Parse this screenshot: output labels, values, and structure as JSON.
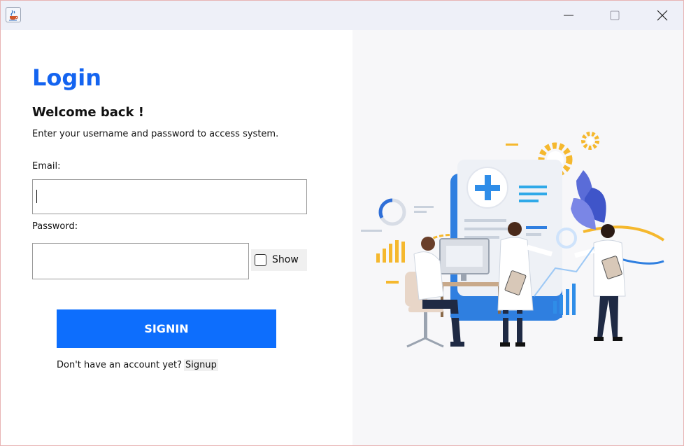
{
  "window": {
    "app_icon": "java-cup-icon",
    "controls": [
      "minimize-icon",
      "maximize-icon",
      "close-icon"
    ]
  },
  "login": {
    "title": "Login",
    "subtitle": "Welcome back !",
    "description": "Enter your username and password to access system.",
    "email_label": "Email:",
    "email_value": "",
    "password_label": "Password:",
    "password_value": "",
    "show_label": "Show",
    "show_checked": false,
    "signin_label": "SIGNIN",
    "signup_prompt": "Don't have an account yet?",
    "signup_link": "Signup"
  },
  "colors": {
    "accent": "#0d6efd",
    "title": "#1464f0",
    "illustration_bg": "#f7f7f9",
    "illustration_yellow": "#f5b82e",
    "illustration_blue": "#2f7fe0"
  },
  "illustration": {
    "name": "healthcare-team-illustration"
  }
}
